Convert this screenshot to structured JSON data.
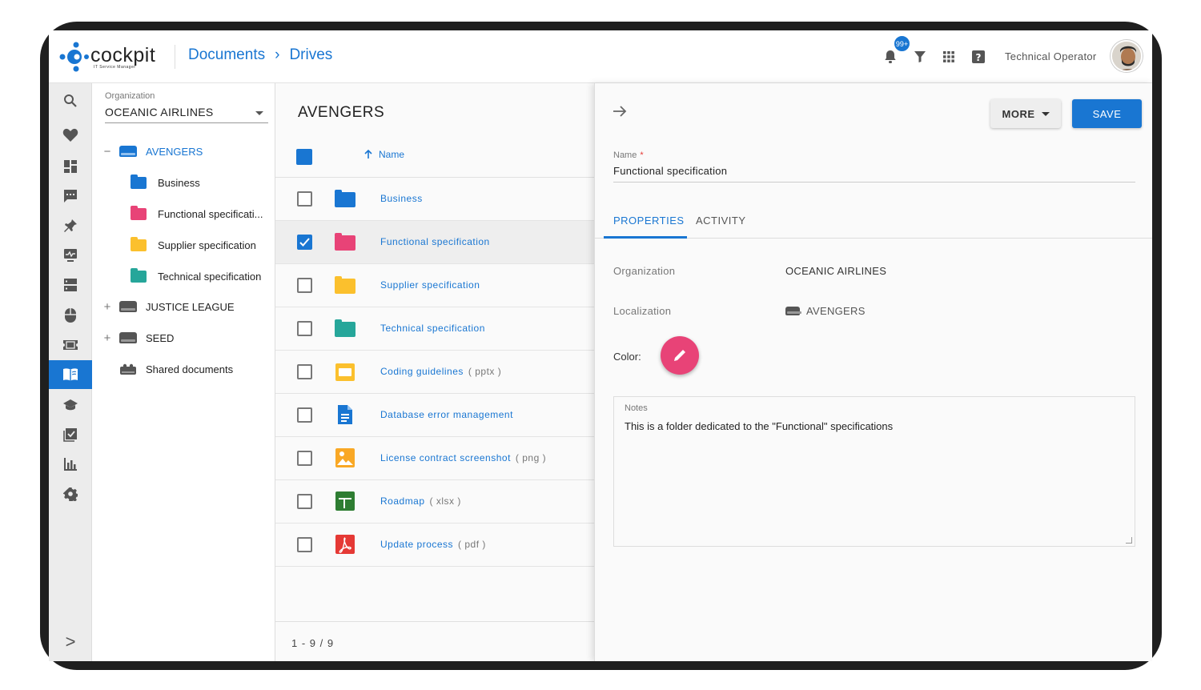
{
  "header": {
    "logo_text": "cockpit",
    "logo_subtitle": "IT Service Manager",
    "breadcrumbs": [
      "Documents",
      "Drives"
    ],
    "notification_count": "99+",
    "user_name": "Technical  Operator"
  },
  "rail": {
    "items": [
      "search",
      "favorites",
      "dashboard",
      "chat",
      "pin",
      "monitoring",
      "servers",
      "mouse",
      "tickets",
      "documents",
      "learning",
      "tasks",
      "reports",
      "settings"
    ],
    "active": "documents",
    "expand_icon": ">"
  },
  "tree": {
    "org_label": "Organization",
    "org_value": "OCEANIC AIRLINES",
    "items": [
      {
        "toggle": "−",
        "label": "AVENGERS",
        "color": "#1976d2"
      },
      {
        "label": "Business",
        "color": "#1976d2"
      },
      {
        "label": "Functional specificati...",
        "color": "#e84377"
      },
      {
        "label": "Supplier specification",
        "color": "#fbc02d"
      },
      {
        "label": "Technical specification",
        "color": "#26a69a"
      },
      {
        "toggle": "+",
        "label": "JUSTICE LEAGUE"
      },
      {
        "toggle": "+",
        "label": "SEED"
      },
      {
        "label": "Shared documents"
      }
    ]
  },
  "list": {
    "title": "AVENGERS",
    "sort_label": "Name",
    "rows": [
      {
        "name": "Business",
        "ext": "",
        "checked": false
      },
      {
        "name": "Functional specification",
        "ext": "",
        "checked": true
      },
      {
        "name": "Supplier specification",
        "ext": "",
        "checked": false
      },
      {
        "name": "Technical specification",
        "ext": "",
        "checked": false
      },
      {
        "name": "Coding guidelines",
        "ext": "( pptx )",
        "checked": false
      },
      {
        "name": "Database error management",
        "ext": "",
        "checked": false
      },
      {
        "name": "License contract screenshot",
        "ext": "( png )",
        "checked": false
      },
      {
        "name": "Roadmap",
        "ext": "( xlsx )",
        "checked": false
      },
      {
        "name": "Update process",
        "ext": "( pdf )",
        "checked": false
      }
    ],
    "pagination": "1 - 9 / 9"
  },
  "detail": {
    "more_label": "MORE",
    "save_label": "SAVE",
    "name_label": "Name",
    "name_required": "*",
    "name_value": "Functional specification",
    "tabs": [
      "PROPERTIES",
      "ACTIVITY"
    ],
    "properties": {
      "organization_label": "Organization",
      "organization_value": "OCEANIC AIRLINES",
      "localization_label": "Localization",
      "localization_value": "AVENGERS",
      "color_label": "Color:"
    },
    "notes_label": "Notes",
    "notes_value": "This is a folder dedicated to the \"Functional\" specifications"
  },
  "colors": {
    "accent": "#1976d2",
    "pink": "#e84377",
    "yellow": "#fbc02d",
    "teal": "#26a69a"
  }
}
